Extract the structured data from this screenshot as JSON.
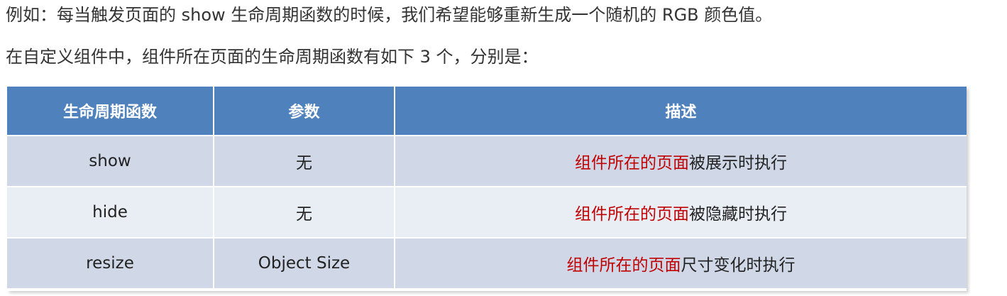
{
  "paragraphs": {
    "intro": "例如：每当触发页面的 show 生命周期函数的时候，我们希望能够重新生成一个随机的 RGB 颜色值。",
    "lead": "在自定义组件中，组件所在页面的生命周期函数有如下 3 个，分别是："
  },
  "table": {
    "headers": [
      "生命周期函数",
      "参数",
      "描述"
    ],
    "rows": [
      {
        "fn": "show",
        "param": "无",
        "desc_highlight": "组件所在的页面",
        "desc_rest": "被展示时执行"
      },
      {
        "fn": "hide",
        "param": "无",
        "desc_highlight": "组件所在的页面",
        "desc_rest": "被隐藏时执行"
      },
      {
        "fn": "resize",
        "param": "Object Size",
        "desc_highlight": "组件所在的页面",
        "desc_rest": "尺寸变化时执行"
      }
    ]
  },
  "colors": {
    "header_bg": "#4f81bd",
    "row_odd_bg": "#d0d8e8",
    "row_even_bg": "#e9edf4",
    "highlight_text": "#c00000"
  }
}
